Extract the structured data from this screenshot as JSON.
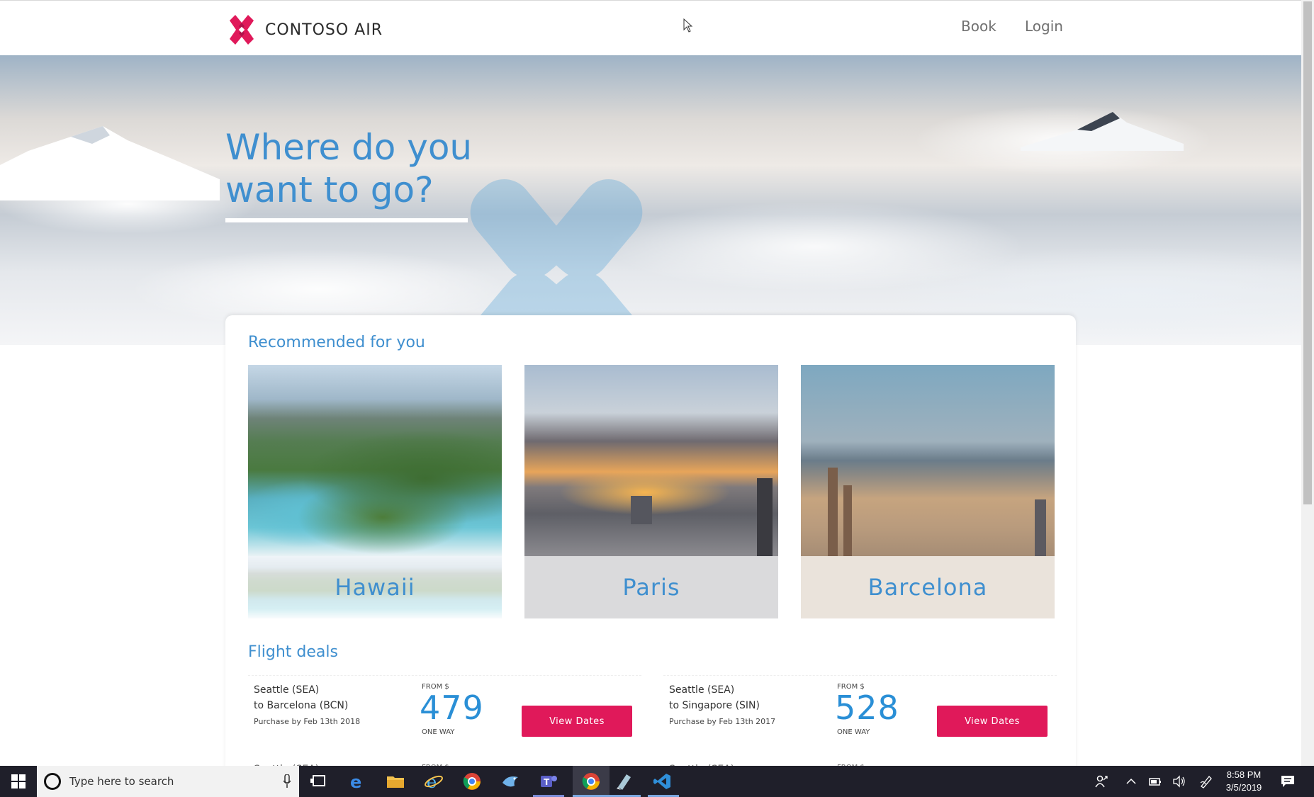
{
  "header": {
    "brand": "CONTOSO AIR",
    "nav": {
      "book": "Book",
      "login": "Login"
    },
    "accent_color": "#e0195a",
    "brand_blue": "#3f8fcf"
  },
  "hero": {
    "title_line1": "Where do you",
    "title_line2": "want to go?"
  },
  "recommended": {
    "title": "Recommended for you",
    "destinations": [
      {
        "name": "Hawaii"
      },
      {
        "name": "Paris"
      },
      {
        "name": "Barcelona"
      }
    ]
  },
  "deals": {
    "title": "Flight deals",
    "items": [
      {
        "from": "Seattle (SEA)",
        "to": "to Barcelona (BCN)",
        "purchase_by": "Purchase by Feb 13th 2018",
        "from_label": "FROM $",
        "price": "479",
        "type": "ONE WAY",
        "button": "View Dates"
      },
      {
        "from": "Seattle (SEA)",
        "to": "to Singapore (SIN)",
        "purchase_by": "Purchase by Feb 13th 2017",
        "from_label": "FROM $",
        "price": "528",
        "type": "ONE WAY",
        "button": "View Dates"
      }
    ],
    "partial_row": [
      "Seattle (SEA)",
      "FROM $",
      "Seattle (SEA)",
      "FROM $"
    ]
  },
  "taskbar": {
    "search_placeholder": "Type here to search",
    "time": "8:58 PM",
    "date": "3/5/2019",
    "apps": [
      "edge-icon",
      "file-explorer-icon",
      "internet-explorer-icon",
      "chrome-icon",
      "bird-app-icon",
      "teams-icon",
      "chrome-active-icon",
      "notes-app-icon",
      "vscode-icon"
    ]
  }
}
